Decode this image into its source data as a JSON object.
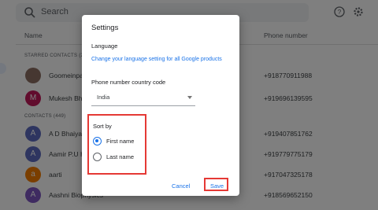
{
  "search": {
    "placeholder": "Search"
  },
  "header": {
    "help_icon": "help-icon",
    "settings_icon": "gear-icon"
  },
  "table": {
    "columns": {
      "name": "Name",
      "phone": "Phone number"
    }
  },
  "sections": {
    "starred": "STARRED CONTACTS (2)",
    "contacts": "CONTACTS (449)"
  },
  "contacts": [
    {
      "initial": "",
      "name": "Goomeinpal",
      "phone": "+918770911988",
      "color": "#8d6e63"
    },
    {
      "initial": "M",
      "name": "Mukesh Bha",
      "phone": "+919696139595",
      "color": "#c2185b"
    },
    {
      "initial": "A",
      "name": "A D Bhaiya",
      "phone": "+919407851762",
      "color": "#5c6bc0"
    },
    {
      "initial": "A",
      "name": "Aamir P.U Hi",
      "phone": "+919779775179",
      "color": "#5c6bc0"
    },
    {
      "initial": "a",
      "name": "aarti",
      "phone": "+917047325178",
      "color": "#f57c00"
    },
    {
      "initial": "A",
      "name": "Aashni Biophysics",
      "phone": "+918569652150",
      "color": "#7e57c2"
    }
  ],
  "dialog": {
    "title": "Settings",
    "language_label": "Language",
    "language_link": "Change your language setting for all Google products",
    "country_label": "Phone number country code",
    "country_value": "India",
    "sort_label": "Sort by",
    "sort_options": [
      {
        "label": "First name",
        "selected": true
      },
      {
        "label": "Last name",
        "selected": false
      }
    ],
    "cancel_label": "Cancel",
    "save_label": "Save"
  },
  "colors": {
    "accent": "#1a73e8",
    "highlight": "#e53935",
    "scrim": "rgba(0,0,0,0.5)"
  }
}
